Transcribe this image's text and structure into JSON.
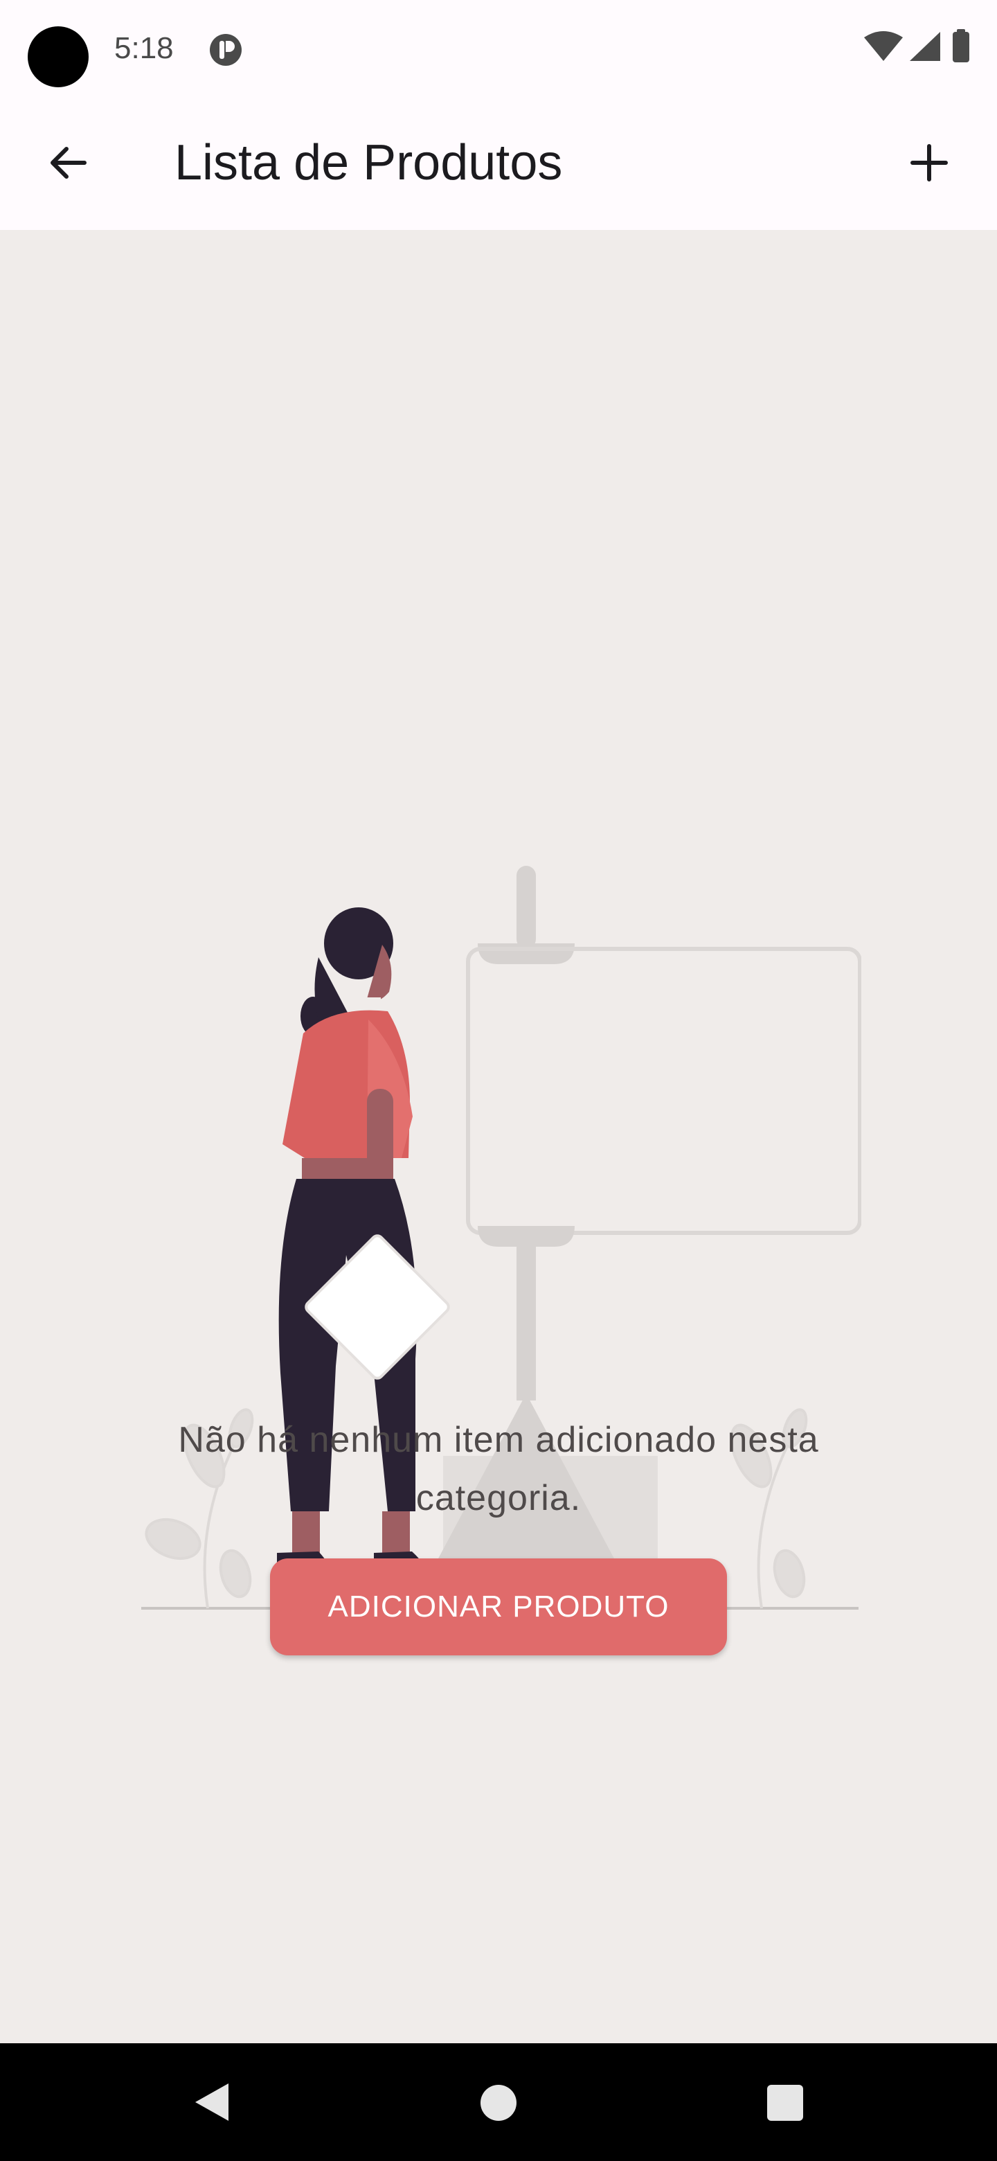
{
  "status_bar": {
    "time": "5:18",
    "icons": [
      "wifi-icon",
      "signal-icon",
      "battery-icon"
    ]
  },
  "app_bar": {
    "title": "Lista de Produtos",
    "back_icon": "arrow-back-icon",
    "add_icon": "plus-icon"
  },
  "empty_state": {
    "message": "Não há nenhum item adicionado nesta categoria.",
    "button_label": "ADICIONAR PRODUTO"
  },
  "nav_bar": {
    "icons": [
      "nav-back-icon",
      "nav-home-icon",
      "nav-recents-icon"
    ]
  },
  "colors": {
    "background": "#F0ECEA",
    "app_bar": "#FFFBFE",
    "accent": "#E06B6B",
    "figure_shirt": "#D9605F",
    "figure_dark": "#2A2234"
  }
}
